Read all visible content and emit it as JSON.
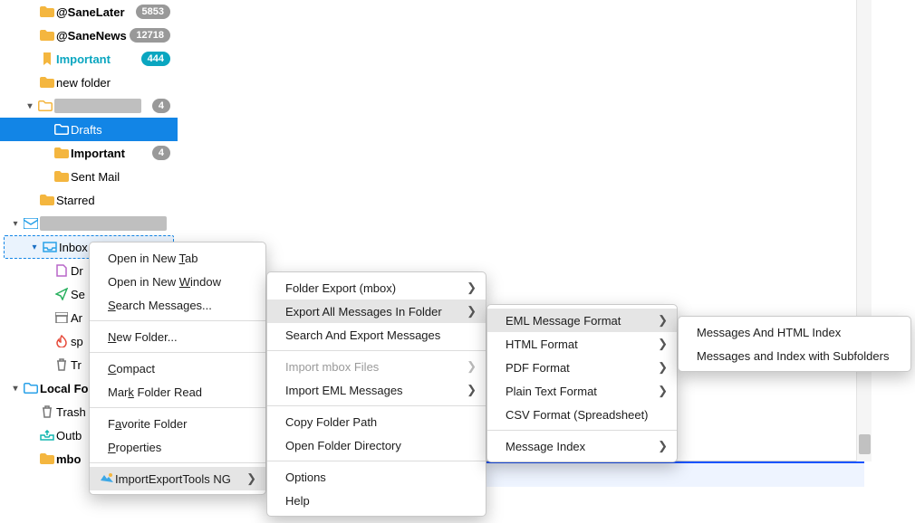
{
  "sidebar": {
    "items": [
      {
        "label": "@SaneLater",
        "badge": "5853",
        "bold": true
      },
      {
        "label": "@SaneNews",
        "badge": "12718",
        "bold": true
      },
      {
        "label": "Important",
        "badge": "444",
        "bold": true,
        "teal": true
      },
      {
        "label": "new folder"
      },
      {
        "label": "",
        "redacted": true,
        "badge": "4",
        "expand": "open",
        "bold": true
      },
      {
        "label": "Drafts",
        "selected": true
      },
      {
        "label": "Important",
        "badge": "4",
        "bold": true
      },
      {
        "label": "Sent Mail"
      },
      {
        "label": "Starred"
      },
      {
        "label": "",
        "redacted": true,
        "expand": "open",
        "account2": true
      },
      {
        "label": "Inbox",
        "inbox": true,
        "expand": "open"
      },
      {
        "label": "Dr"
      },
      {
        "label": "Se"
      },
      {
        "label": "Ar"
      },
      {
        "label": "sp",
        "fire": true
      },
      {
        "label": "Tr",
        "trash": true
      },
      {
        "label": "Local Fo",
        "bold": true,
        "expand": "open",
        "depth0": true
      },
      {
        "label": "Trash",
        "trash": true
      },
      {
        "label": "Outb",
        "out": true
      },
      {
        "label": "mbo",
        "bold": true
      }
    ]
  },
  "menu1": [
    {
      "label": "Open in New Tab",
      "m": "T"
    },
    {
      "label": "Open in New Window",
      "m": "W"
    },
    {
      "label": "Search Messages...",
      "m": "S"
    },
    {
      "sep": true
    },
    {
      "label": "New Folder...",
      "m": "N"
    },
    {
      "sep": true
    },
    {
      "label": "Compact",
      "m": "C"
    },
    {
      "label": "Mark Folder Read",
      "m": "k"
    },
    {
      "sep": true
    },
    {
      "label": "Favorite Folder",
      "m": "a"
    },
    {
      "label": "Properties",
      "m": "P"
    },
    {
      "sep": true
    },
    {
      "label": "ImportExportTools NG",
      "sub": true,
      "icon": true,
      "hl": true
    }
  ],
  "menu2": [
    {
      "label": "Folder Export (mbox)",
      "sub": true
    },
    {
      "label": "Export All Messages In Folder",
      "sub": true,
      "hl": true
    },
    {
      "label": "Search And Export Messages"
    },
    {
      "sep": true
    },
    {
      "label": "Import mbox Files",
      "sub": true,
      "disabled": true
    },
    {
      "label": "Import EML Messages",
      "sub": true
    },
    {
      "sep": true
    },
    {
      "label": "Copy Folder Path"
    },
    {
      "label": "Open Folder Directory"
    },
    {
      "sep": true
    },
    {
      "label": "Options"
    },
    {
      "label": "Help"
    }
  ],
  "menu3": [
    {
      "label": "EML Message Format",
      "sub": true,
      "hl": true
    },
    {
      "label": "HTML Format",
      "sub": true
    },
    {
      "label": "PDF Format",
      "sub": true
    },
    {
      "label": "Plain Text Format",
      "sub": true
    },
    {
      "label": "CSV Format (Spreadsheet)"
    },
    {
      "sep": true
    },
    {
      "label": "Message Index",
      "sub": true
    }
  ],
  "menu4": [
    {
      "label": "Messages And HTML Index"
    },
    {
      "label": "Messages and Index with Subfolders"
    }
  ]
}
